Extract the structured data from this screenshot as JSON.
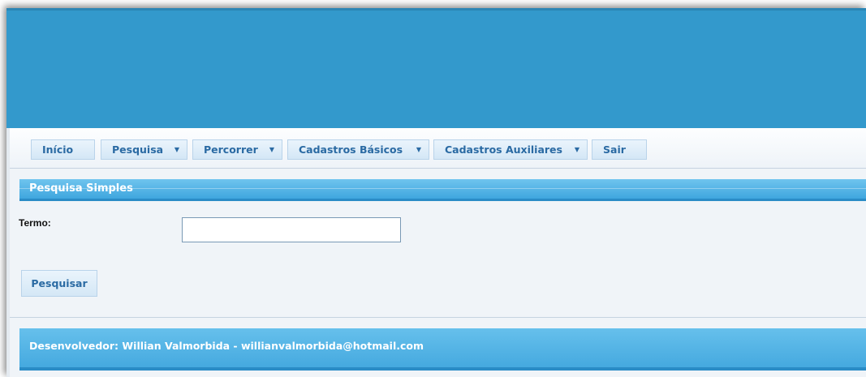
{
  "menu": {
    "items": [
      {
        "label": "Início",
        "has_dropdown": false
      },
      {
        "label": "Pesquisa",
        "has_dropdown": true
      },
      {
        "label": "Percorrer",
        "has_dropdown": true
      },
      {
        "label": "Cadastros Básicos",
        "has_dropdown": true
      },
      {
        "label": "Cadastros Auxiliares",
        "has_dropdown": true
      },
      {
        "label": "Sair",
        "has_dropdown": false
      }
    ],
    "caret_glyph": "▼"
  },
  "search_panel": {
    "header": "Pesquisa Simples",
    "term_label": "Termo:",
    "term_value": "",
    "submit_label": "Pesquisar"
  },
  "footer": {
    "text": "Desenvolvedor: Willian Valmorbida - willianvalmorbida@hotmail.com"
  },
  "colors": {
    "banner": "#3399cc",
    "accent": "#2a6aa3",
    "header_bar": "#45a9df"
  }
}
